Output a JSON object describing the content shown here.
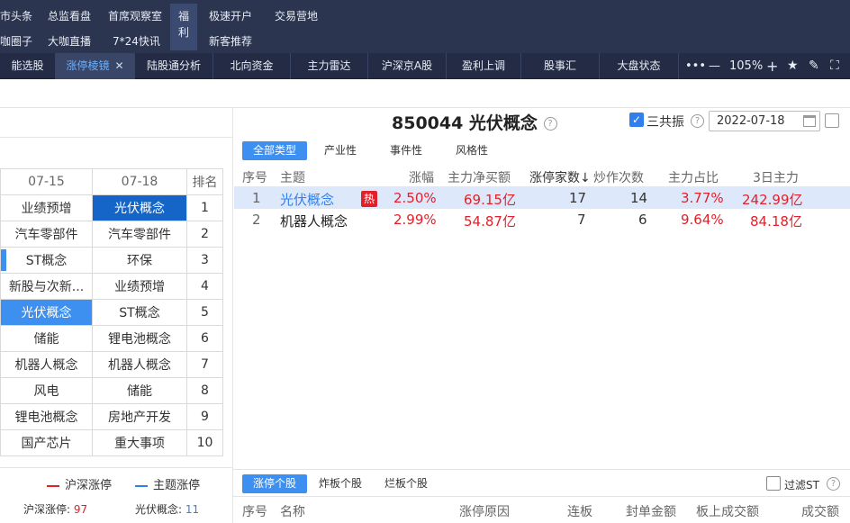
{
  "topnav": {
    "row1": [
      "市头条",
      "总监看盘",
      "首席观察室",
      "极速开户",
      "交易营地"
    ],
    "row2": [
      "咖圈子",
      "大咖直播",
      "7*24快讯",
      "新客推荐"
    ],
    "fuli": [
      "福",
      "利"
    ]
  },
  "tabs": [
    {
      "label": "能选股"
    },
    {
      "label": "涨停棱镜",
      "close": "✕"
    },
    {
      "label": "陆股通分析"
    },
    {
      "label": "北向资金"
    },
    {
      "label": "主力雷达"
    },
    {
      "label": "沪深京A股"
    },
    {
      "label": "盈利上调"
    },
    {
      "label": "股事汇"
    },
    {
      "label": "大盘状态"
    }
  ],
  "toolbar": {
    "more": "•••",
    "minus": "—",
    "zoom": "105%",
    "plus": "+",
    "star": "★",
    "pen": "✎",
    "expand": "⛶"
  },
  "left_table": {
    "headers": [
      "07-15",
      "07-18",
      "排名"
    ],
    "rows": [
      {
        "a": "业绩预增",
        "b": "光伏概念",
        "r": "1"
      },
      {
        "a": "汽车零部件",
        "b": "汽车零部件",
        "r": "2"
      },
      {
        "a": "ST概念",
        "b": "环保",
        "r": "3"
      },
      {
        "a": "新股与次新...",
        "b": "业绩预增",
        "r": "4"
      },
      {
        "a": "光伏概念",
        "b": "ST概念",
        "r": "5"
      },
      {
        "a": "储能",
        "b": "锂电池概念",
        "r": "6"
      },
      {
        "a": "机器人概念",
        "b": "机器人概念",
        "r": "7"
      },
      {
        "a": "风电",
        "b": "储能",
        "r": "8"
      },
      {
        "a": "锂电池概念",
        "b": "房地产开发",
        "r": "9"
      },
      {
        "a": "国产芯片",
        "b": "重大事项",
        "r": "10"
      }
    ]
  },
  "legend": {
    "hs": "沪深涨停",
    "topic": "主题涨停",
    "hs_count_label": "沪深涨停:",
    "hs_count": "97",
    "topic_count_label": "光伏概念:",
    "topic_count": "11",
    "red": "#e0212a",
    "blue": "#2f80ed"
  },
  "detail": {
    "title": "850044 光伏概念",
    "help": "?",
    "sangongzhen": "三共振",
    "date": "2022-07-18",
    "filters": [
      "全部类型",
      "产业性",
      "事件性",
      "风格性"
    ],
    "columns": [
      "序号",
      "主题",
      "涨幅",
      "主力净买额",
      "涨停家数↓",
      "炒作次数",
      "主力占比",
      "3日主力"
    ],
    "rows": [
      {
        "idx": "1",
        "name": "光伏概念",
        "hot": "热",
        "pct": "2.50%",
        "net": "69.15亿",
        "count": "17",
        "times": "14",
        "ratio": "3.77%",
        "three": "242.99亿"
      },
      {
        "idx": "2",
        "name": "机器人概念",
        "hot": "",
        "pct": "2.99%",
        "net": "54.87亿",
        "count": "7",
        "times": "6",
        "ratio": "9.64%",
        "three": "84.18亿"
      }
    ]
  },
  "bottom": {
    "tabs": [
      "涨停个股",
      "炸板个股",
      "烂板个股"
    ],
    "filter_st": "过滤ST",
    "columns": [
      "序号",
      "名称",
      "涨停原因",
      "连板",
      "封单金额",
      "板上成交额",
      "成交额"
    ]
  }
}
